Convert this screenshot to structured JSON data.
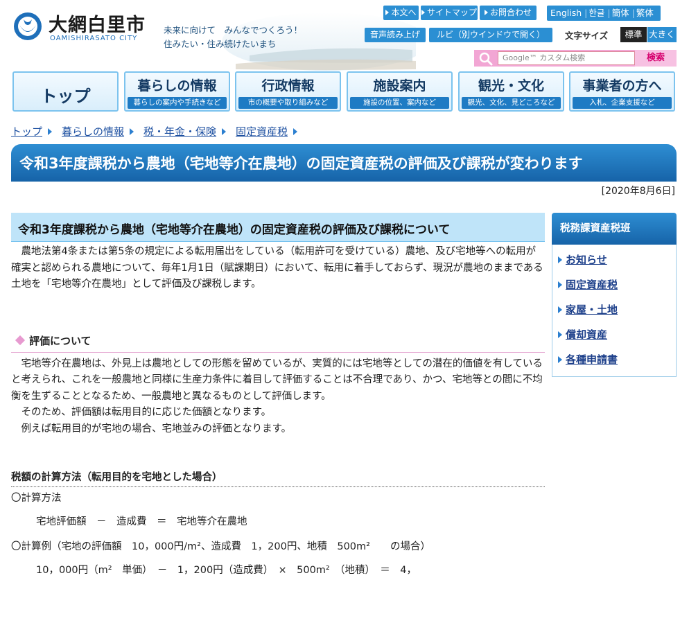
{
  "header": {
    "logo_name": "大網白里市",
    "logo_roman": "OAMISHIRASATO CITY",
    "slogan_line1": "未来に向けて　みんなでつくろう！",
    "slogan_line2": "住みたい・住み続けたいまち",
    "utility_links": {
      "main_text": "本文へ",
      "sitemap": "サイトマップ",
      "contact": "お問合わせ",
      "read_aloud": "音声読み上げ",
      "ruby": "ルビ（別ウインドウで開く）"
    },
    "languages": [
      "English",
      "한글",
      "簡体",
      "繁体"
    ],
    "font_size": {
      "label": "文字サイズ",
      "standard": "標準",
      "large": "大きく"
    },
    "search": {
      "placeholder": "Google™ カスタム検索",
      "button": "検索"
    }
  },
  "global_nav": [
    {
      "label": "トップ",
      "sub": ""
    },
    {
      "label": "暮らしの情報",
      "sub": "暮らしの案内や手続きなど"
    },
    {
      "label": "行政情報",
      "sub": "市の概要や取り組みなど"
    },
    {
      "label": "施設案内",
      "sub": "施設の位置、案内など"
    },
    {
      "label": "観光・文化",
      "sub": "観光、文化、見どころなど"
    },
    {
      "label": "事業者の方へ",
      "sub": "入札、企業支援など"
    }
  ],
  "breadcrumb": [
    "トップ",
    "暮らしの情報",
    "税・年金・保険",
    "固定資産税"
  ],
  "page": {
    "title": "令和3年度課税から農地（宅地等介在農地）の固定資産税の評価及び課税が変わります",
    "date": "[2020年8月6日]"
  },
  "content": {
    "heading": "令和3年度課税から農地（宅地等介在農地）の固定資産税の評価及び課税について",
    "intro": "農地法第4条または第5条の規定による転用届出をしている（転用許可を受けている）農地、及び宅地等への転用が確実と認められる農地について、毎年1月1日（賦課期日）において、転用に着手しておらず、現況が農地のままである土地を「宅地等介在農地」として評価及び課税します。",
    "eval_heading": "評価について",
    "eval_p1": "宅地等介在農地は、外見上は農地としての形態を留めているが、実質的には宅地等としての潜在的価値を有していると考えられ、これを一般農地と同様に生産力条件に着目して評価することは不合理であり、かつ、宅地等との間に不均衡を生ずることとなるため、一般農地と異なるものとして評価します。",
    "eval_p2": "そのため、評価額は転用目的に応じた価額となります。",
    "eval_p3": "例えば転用目的が宅地の場合、宅地並みの評価となります。",
    "calc_heading": "税額の計算方法（転用目的を宅地とした場合）",
    "calc_method_label": "〇計算方法",
    "calc_formula": "宅地評価額　－　造成費　＝　宅地等介在農地",
    "calc_example_label": "〇計算例（宅地の評価額　10，000円/m²、造成費　1，200円、地積　500m²　　の場合）",
    "calc_example_line": "10，000円（m²　単価）　－　1，200円（造成費）　×　500m²　（地積）　＝　4，"
  },
  "sidebar": {
    "title": "税務課資産税班",
    "items": [
      "お知らせ",
      "固定資産税",
      "家屋・土地",
      "償却資産",
      "各種申請書"
    ]
  },
  "colors": {
    "accent_blue": "#2b8fd3",
    "title_blue": "#1663a8",
    "search_pink": "#f2a6d4",
    "heading_bg": "#bfe4f9"
  }
}
